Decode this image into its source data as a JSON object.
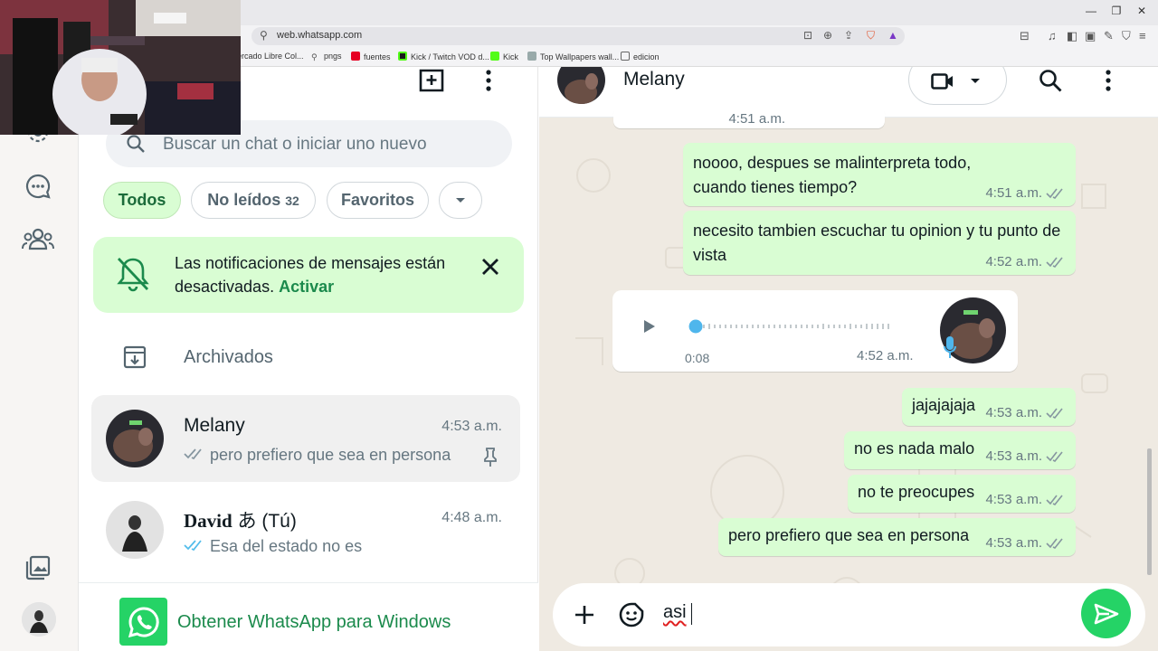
{
  "browser": {
    "url": "web.whatsapp.com",
    "bookmarks": [
      {
        "label": "ercado Libre Col...",
        "icon": "mercadolibre-icon"
      },
      {
        "label": "pngs",
        "icon": "pin-icon"
      },
      {
        "label": "fuentes",
        "icon": "pinterest-icon"
      },
      {
        "label": "Kick / Twitch VOD d...",
        "icon": "kick-vod-icon"
      },
      {
        "label": "Kick",
        "icon": "kick-icon"
      },
      {
        "label": "Top Wallpapers wall...",
        "icon": "wallpapers-icon"
      },
      {
        "label": "edicion",
        "icon": "folder-icon"
      }
    ]
  },
  "sidebar": {
    "search_placeholder": "Buscar un chat o iniciar uno nuevo",
    "filters": {
      "all": "Todos",
      "unread": "No leídos",
      "unread_count": "32",
      "favorites": "Favoritos"
    },
    "notification": {
      "text": "Las notificaciones de mensajes están desactivadas.",
      "action": "Activar"
    },
    "archived_label": "Archivados",
    "chats": [
      {
        "name": "Melany",
        "time": "4:53 a.m.",
        "preview": "pero prefiero que sea en persona",
        "pinned": true
      },
      {
        "name": "David",
        "name_suffix": "あ (Tú)",
        "time": "4:48 a.m.",
        "preview": "Esa del estado no es"
      }
    ],
    "get_app_label": "Obtener WhatsApp para Windows"
  },
  "conversation": {
    "contact_name": "Melany",
    "messages": [
      {
        "text": "noooo, despues se malinterpreta todo, cuando tienes tiempo?",
        "time": "4:51 a.m."
      },
      {
        "text": "necesito tambien escuchar tu opinion y tu punto de vista",
        "time": "4:52 a.m."
      },
      {
        "text": "jajajajaja",
        "time": "4:53 a.m."
      },
      {
        "text": "no es nada malo",
        "time": "4:53 a.m."
      },
      {
        "text": "no te preocupes",
        "time": "4:53 a.m."
      },
      {
        "text": "pero prefiero que sea en persona",
        "time": "4:53 a.m."
      }
    ],
    "partial_time": "4:51 a.m.",
    "voice_note": {
      "duration": "0:08",
      "time": "4:52 a.m.",
      "progress": 0
    },
    "composer_text": "asi"
  },
  "colors": {
    "accent": "#25d366",
    "bubble_out": "#d9fdd3",
    "chip_active": "#d9fdd3",
    "read_ticks": "#53bdeb",
    "text_link": "#1b8a4c"
  }
}
